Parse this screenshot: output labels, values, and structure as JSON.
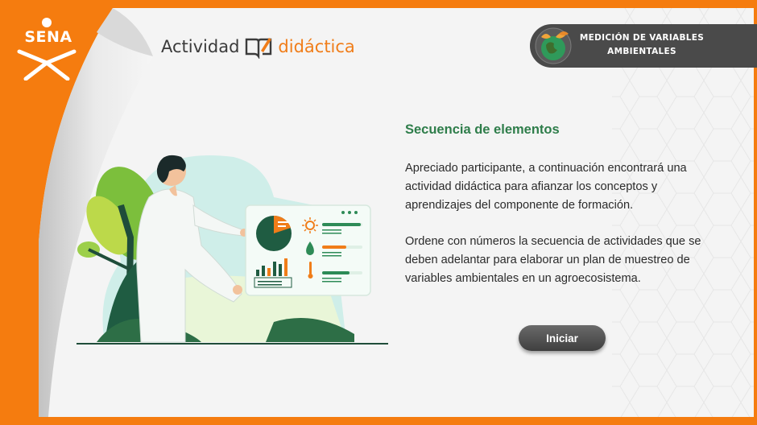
{
  "brand": {
    "logo_text": "SENA"
  },
  "header": {
    "activity_word1": "Actividad",
    "activity_word2": "didáctica",
    "module_line1": "MEDICIÓN DE VARIABLES",
    "module_line2": "AMBIENTALES"
  },
  "content": {
    "title": "Secuencia de elementos",
    "paragraph1": "Apreciado participante, a continuación encontrará una actividad didáctica para afianzar los conceptos y aprendizajes del componente de formación.",
    "paragraph2": "Ordene con números la secuencia de actividades que se deben adelantar para elaborar un plan de muestreo de variables ambientales en un agroecosistema.",
    "start_label": "Iniciar"
  },
  "colors": {
    "frame": "#f57c0f",
    "accent_green": "#2e7d4a",
    "badge": "#4a4a4a"
  },
  "icons": [
    "sena-logo-icon",
    "book-pencil-icon",
    "globe-leaves-icon"
  ]
}
